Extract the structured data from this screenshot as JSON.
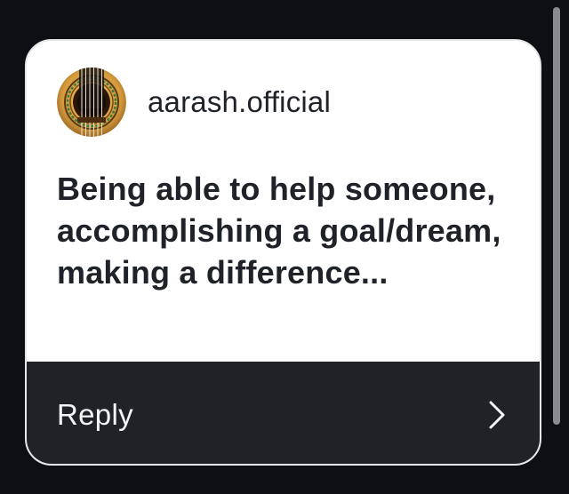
{
  "notification": {
    "username": "aarash.official",
    "avatar_icon": "guitar-soundhole-icon",
    "message": "Being able to help someone, accomplishing a goal/dream, making a difference...",
    "reply_label": "Reply",
    "reply_chevron_icon": "chevron-right-icon"
  },
  "colors": {
    "background": "#0d0f13",
    "card_background": "#ffffff",
    "card_border": "#e6e7ea",
    "text_dark": "#1f2329",
    "reply_bar_background": "#202227",
    "reply_text": "#f3f4f6",
    "avatar_wood": "#d8a24a"
  }
}
